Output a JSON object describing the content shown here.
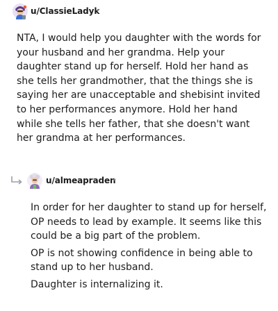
{
  "comments": [
    {
      "username": "u/ClassieLadyk",
      "separator": "•",
      "avatar_icon": "reddit-avatar-icon",
      "paragraphs": [
        "NTA, I would help you daughter with the words for your husband and her grandma. Help your daughter stand up for herself. Hold her hand as she tells her grandmother, that the things she is saying her are unacceptable and shebisint invited to her performances anymore. Hold her hand while she tells her father, that she doesn't want her grandma at her performances."
      ]
    },
    {
      "username": "u/almeapraden",
      "separator": "•",
      "avatar_icon": "reddit-avatar-icon",
      "reply_icon": "reply-arrow-icon",
      "paragraphs": [
        "In order for her daughter to stand up for herself, OP needs to lead by example. It seems like this could be a big part of the problem.",
        "OP is not showing confidence in being able to stand up to her husband.",
        "Daughter is internalizing it."
      ]
    }
  ]
}
